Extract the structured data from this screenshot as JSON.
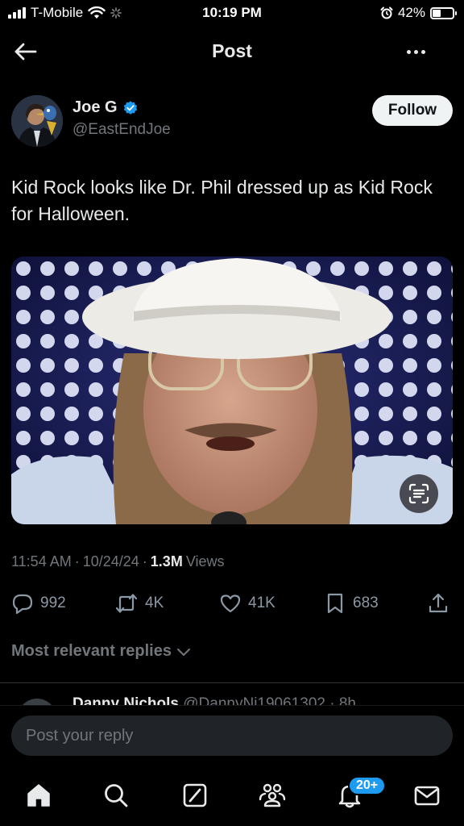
{
  "status_bar": {
    "carrier": "T-Mobile",
    "time": "10:19 PM",
    "battery_percent": "42%",
    "battery_level": 0.42
  },
  "nav": {
    "title": "Post",
    "back_icon": "arrow-left-icon",
    "more_icon": "more-horizontal-icon"
  },
  "author": {
    "name": "Joe G",
    "handle": "@EastEndJoe",
    "verified": true,
    "follow_label": "Follow"
  },
  "post": {
    "text": "Kid Rock looks like Dr. Phil dressed up as Kid Rock for Halloween.",
    "time": "11:54 AM",
    "date": "10/24/24",
    "views_count": "1.3M",
    "views_label": "Views"
  },
  "actions": {
    "replies": "992",
    "reposts": "4K",
    "likes": "41K",
    "bookmarks": "683"
  },
  "replies": {
    "filter_label": "Most relevant replies",
    "peek_name": "Danny Nichols",
    "peek_handle": "@DannyNi19061302 · 8h"
  },
  "reply_bar": {
    "placeholder": "Post your reply"
  },
  "tab_bar": {
    "notifications_badge": "20+"
  },
  "colors": {
    "background": "#000000",
    "text_primary": "#e7e9ea",
    "text_secondary": "#71767b",
    "accent_blue": "#1d9bf0",
    "follow_button_bg": "#eff3f4"
  }
}
